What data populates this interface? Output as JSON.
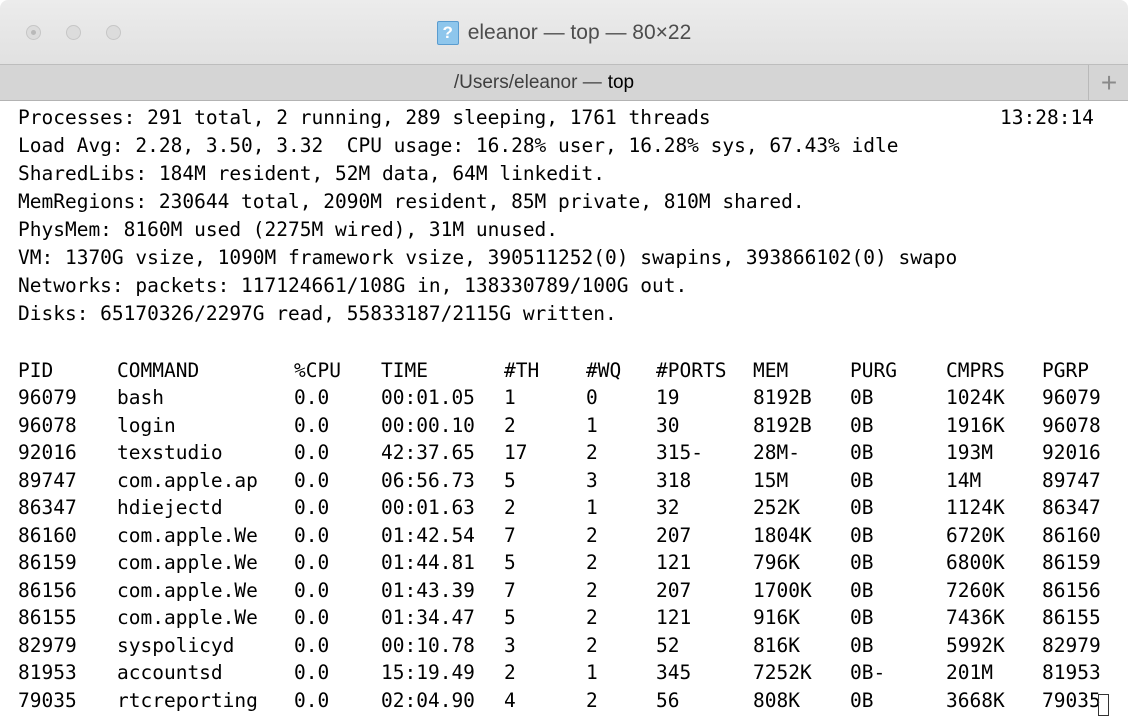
{
  "window": {
    "title": "eleanor — top — 80×22",
    "icon": "terminal-document-icon"
  },
  "tab": {
    "path": "/Users/eleanor —",
    "command": "top",
    "new_tab_label": "+"
  },
  "summary": {
    "processes": "Processes: 291 total, 2 running, 289 sleeping, 1761 threads",
    "clock": "13:28:14",
    "load_avg": "Load Avg: 2.28, 3.50, 3.32  CPU usage: 16.28% user, 16.28% sys, 67.43% idle",
    "shared_libs": "SharedLibs: 184M resident, 52M data, 64M linkedit.",
    "mem_regions": "MemRegions: 230644 total, 2090M resident, 85M private, 810M shared.",
    "phys_mem": "PhysMem: 8160M used (2275M wired), 31M unused.",
    "vm": "VM: 1370G vsize, 1090M framework vsize, 390511252(0) swapins, 393866102(0) swapo",
    "networks": "Networks: packets: 117124661/108G in, 138330789/100G out.",
    "disks": "Disks: 65170326/2297G read, 55833187/2115G written."
  },
  "table": {
    "headers": [
      "PID",
      "COMMAND",
      "%CPU",
      "TIME",
      "#TH",
      "#WQ",
      "#PORTS",
      "MEM",
      "PURG",
      "CMPRS",
      "PGRP"
    ],
    "rows": [
      [
        "96079",
        "bash",
        "0.0",
        "00:01.05",
        "1",
        "0",
        "19",
        "8192B",
        "0B",
        "1024K",
        "96079"
      ],
      [
        "96078",
        "login",
        "0.0",
        "00:00.10",
        "2",
        "1",
        "30",
        "8192B",
        "0B",
        "1916K",
        "96078"
      ],
      [
        "92016",
        "texstudio",
        "0.0",
        "42:37.65",
        "17",
        "2",
        "315-",
        "28M-",
        "0B",
        "193M",
        "92016"
      ],
      [
        "89747",
        "com.apple.ap",
        "0.0",
        "06:56.73",
        "5",
        "3",
        "318",
        "15M",
        "0B",
        "14M",
        "89747"
      ],
      [
        "86347",
        "hdiejectd",
        "0.0",
        "00:01.63",
        "2",
        "1",
        "32",
        "252K",
        "0B",
        "1124K",
        "86347"
      ],
      [
        "86160",
        "com.apple.We",
        "0.0",
        "01:42.54",
        "7",
        "2",
        "207",
        "1804K",
        "0B",
        "6720K",
        "86160"
      ],
      [
        "86159",
        "com.apple.We",
        "0.0",
        "01:44.81",
        "5",
        "2",
        "121",
        "796K",
        "0B",
        "6800K",
        "86159"
      ],
      [
        "86156",
        "com.apple.We",
        "0.0",
        "01:43.39",
        "7",
        "2",
        "207",
        "1700K",
        "0B",
        "7260K",
        "86156"
      ],
      [
        "86155",
        "com.apple.We",
        "0.0",
        "01:34.47",
        "5",
        "2",
        "121",
        "916K",
        "0B",
        "7436K",
        "86155"
      ],
      [
        "82979",
        "syspolicyd",
        "0.0",
        "00:10.78",
        "3",
        "2",
        "52",
        "816K",
        "0B",
        "5992K",
        "82979"
      ],
      [
        "81953",
        "accountsd",
        "0.0",
        "15:19.49",
        "2",
        "1",
        "345",
        "7252K",
        "0B-",
        "201M",
        "81953"
      ],
      [
        "79035",
        "rtcreporting",
        "0.0",
        "02:04.90",
        "4",
        "2",
        "56",
        "808K",
        "0B",
        "3668K",
        "79035"
      ]
    ]
  }
}
